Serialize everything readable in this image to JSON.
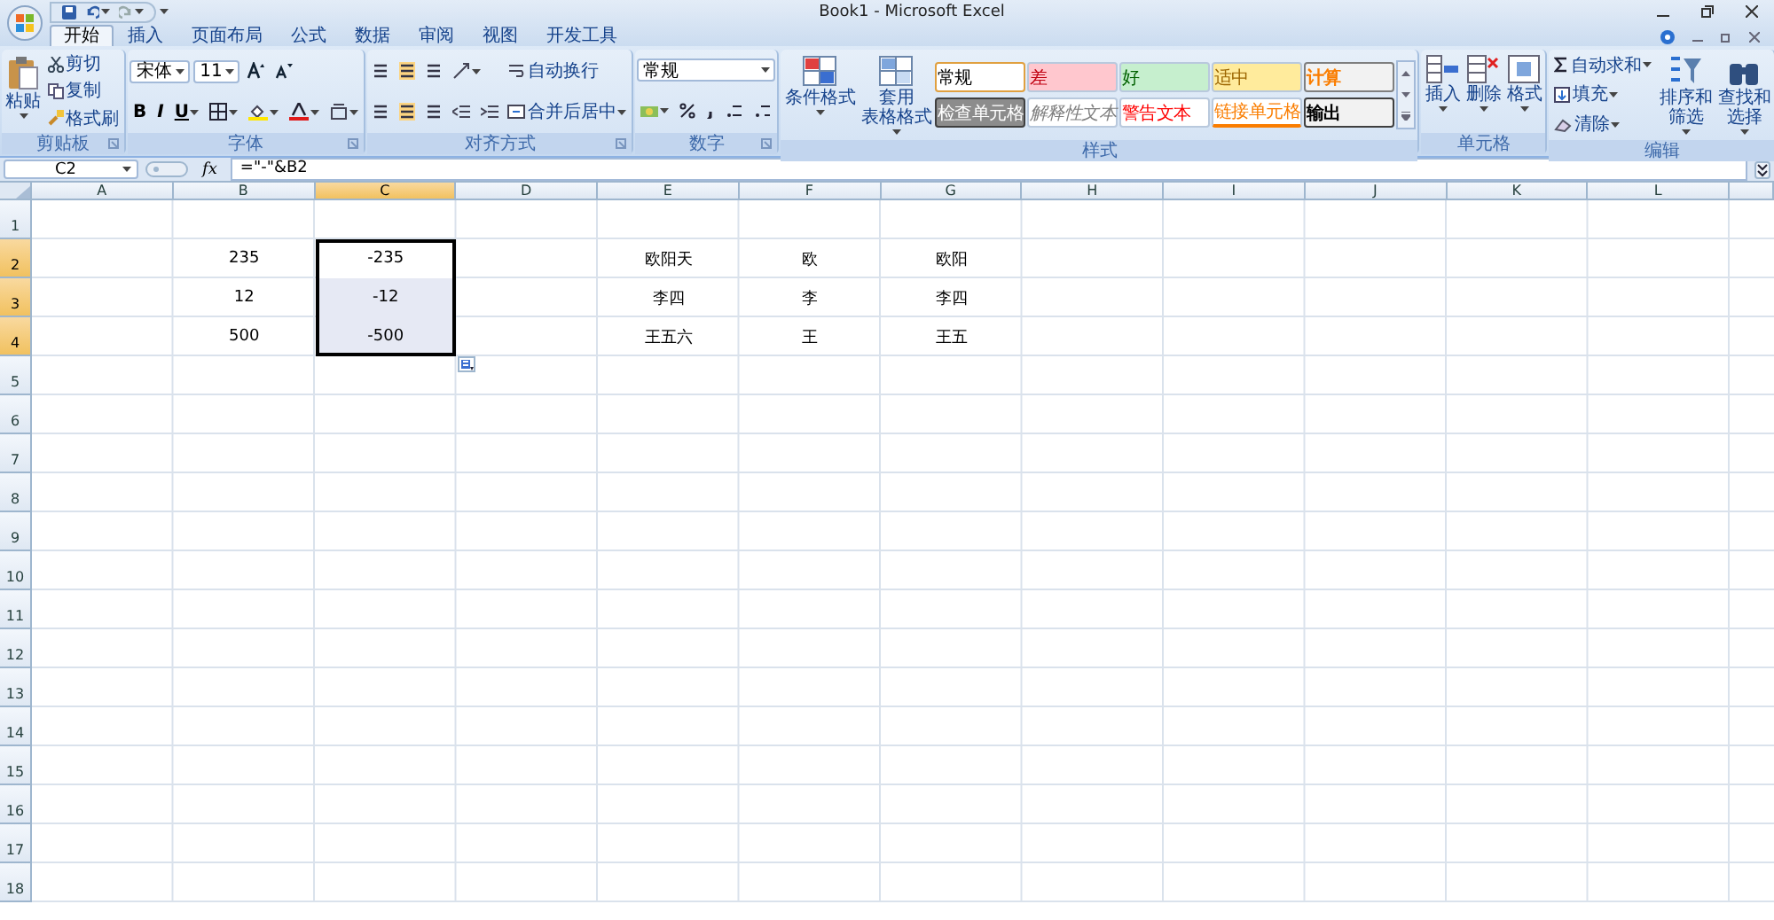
{
  "window": {
    "title": "Book1 - Microsoft Excel"
  },
  "tabs": [
    {
      "label": "开始",
      "selected": true
    },
    {
      "label": "插入",
      "selected": false
    },
    {
      "label": "页面布局",
      "selected": false
    },
    {
      "label": "公式",
      "selected": false
    },
    {
      "label": "数据",
      "selected": false
    },
    {
      "label": "审阅",
      "selected": false
    },
    {
      "label": "视图",
      "selected": false
    },
    {
      "label": "开发工具",
      "selected": false
    }
  ],
  "ribbon": {
    "groups": [
      {
        "kind": "clipboard",
        "label": "剪贴板",
        "paste": "粘贴",
        "items": [
          "剪切",
          "复制",
          "格式刷"
        ]
      },
      {
        "kind": "font",
        "label": "字体",
        "font": "宋体",
        "size": "11",
        "styles": [
          "B",
          "I",
          "U"
        ]
      },
      {
        "kind": "alignment",
        "label": "对齐方式",
        "wrap": "自动换行",
        "merge": "合并后居中"
      },
      {
        "kind": "number",
        "label": "数字",
        "format": "常规"
      },
      {
        "kind": "styles",
        "label": "样式",
        "buttons": [
          [
            "条件格式"
          ],
          [
            "套用",
            "表格格式"
          ]
        ],
        "gallery": [
          {
            "label": "常规",
            "kind": "normal",
            "color": "#ffffff"
          },
          {
            "label": "差",
            "kind": "bad",
            "color": "#ffc7ce"
          },
          {
            "label": "好",
            "kind": "good",
            "color": "#c6efce"
          },
          {
            "label": "适中",
            "kind": "neutral",
            "color": "#ffeb9c"
          },
          {
            "label": "计算",
            "kind": "calculation",
            "color": "#f2f2f2"
          },
          {
            "label": "检查单元格",
            "kind": "check",
            "color": "#8c8c8c"
          },
          {
            "label": "解释性文本",
            "kind": "explanatory",
            "color": "#ffffff"
          },
          {
            "label": "警告文本",
            "kind": "warning",
            "color": "#ffffff"
          },
          {
            "label": "链接单元格",
            "kind": "linked",
            "color": "#ffffff"
          },
          {
            "label": "输出",
            "kind": "output",
            "color": "#f2f2f2"
          }
        ]
      },
      {
        "kind": "cells",
        "label": "单元格",
        "items": [
          "插入",
          "删除",
          "格式"
        ]
      },
      {
        "kind": "editing",
        "label": "编辑",
        "items": [
          "自动求和",
          "填充",
          "清除"
        ],
        "large": [
          [
            "排序和",
            "筛选"
          ],
          [
            "查找和",
            "选择"
          ]
        ]
      }
    ]
  },
  "formula_bar": {
    "name_box": "C2",
    "function_label": "fx",
    "formula": "=\"-\"&B2"
  },
  "sheet": {
    "columns": [
      {
        "label": "A",
        "selected": false
      },
      {
        "label": "B",
        "selected": false
      },
      {
        "label": "C",
        "selected": true
      },
      {
        "label": "D",
        "selected": false
      },
      {
        "label": "E",
        "selected": false
      },
      {
        "label": "F",
        "selected": false
      },
      {
        "label": "G",
        "selected": false
      },
      {
        "label": "H",
        "selected": false
      },
      {
        "label": "I",
        "selected": false
      },
      {
        "label": "J",
        "selected": false
      },
      {
        "label": "K",
        "selected": false
      },
      {
        "label": "L",
        "selected": false
      }
    ],
    "rows": [
      {
        "label": "1",
        "selected": false,
        "cells": []
      },
      {
        "label": "2",
        "selected": true,
        "cells": [
          {},
          {
            "value": "235"
          },
          {
            "value": "-235",
            "selected": true,
            "active": true
          },
          {},
          {
            "value": "欧阳天"
          },
          {
            "value": "欧"
          },
          {
            "value": "欧阳"
          }
        ]
      },
      {
        "label": "3",
        "selected": true,
        "cells": [
          {},
          {
            "value": "12"
          },
          {
            "value": "-12",
            "selected": true,
            "active": false
          },
          {},
          {
            "value": "李四"
          },
          {
            "value": "李"
          },
          {
            "value": "李四"
          }
        ]
      },
      {
        "label": "4",
        "selected": true,
        "cells": [
          {},
          {
            "value": "500"
          },
          {
            "value": "-500",
            "selected": true,
            "active": false
          },
          {},
          {
            "value": "王五六"
          },
          {
            "value": "王"
          },
          {
            "value": "王五"
          }
        ]
      },
      {
        "label": "5",
        "selected": false,
        "cells": []
      },
      {
        "label": "6",
        "selected": false,
        "cells": []
      },
      {
        "label": "7",
        "selected": false,
        "cells": []
      },
      {
        "label": "8",
        "selected": false,
        "cells": []
      },
      {
        "label": "9",
        "selected": false,
        "cells": []
      },
      {
        "label": "10",
        "selected": false,
        "cells": []
      },
      {
        "label": "11",
        "selected": false,
        "cells": []
      },
      {
        "label": "12",
        "selected": false,
        "cells": []
      },
      {
        "label": "13",
        "selected": false,
        "cells": []
      },
      {
        "label": "14",
        "selected": false,
        "cells": []
      },
      {
        "label": "15",
        "selected": false,
        "cells": []
      },
      {
        "label": "16",
        "selected": false,
        "cells": []
      },
      {
        "label": "17",
        "selected": false,
        "cells": []
      },
      {
        "label": "18",
        "selected": false,
        "cells": []
      }
    ]
  }
}
